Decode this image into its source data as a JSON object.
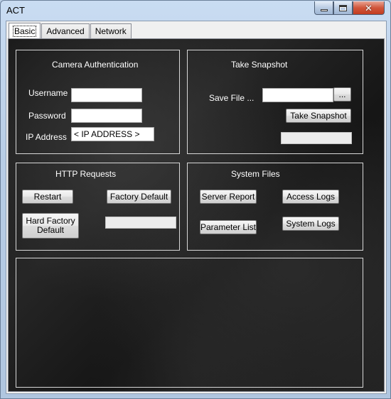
{
  "window": {
    "title": "ACT"
  },
  "tabs": [
    {
      "label": "Basic",
      "active": true
    },
    {
      "label": "Advanced",
      "active": false
    },
    {
      "label": "Network",
      "active": false
    }
  ],
  "camera_auth": {
    "title": "Camera Authentication",
    "username_label": "Username",
    "username_value": "",
    "password_label": "Password",
    "password_value": "",
    "ip_label": "IP Address",
    "ip_value": "< IP ADDRESS >"
  },
  "snapshot": {
    "title": "Take Snapshot",
    "save_file_label": "Save File ...",
    "save_file_value": "",
    "browse_label": "...",
    "take_label": "Take Snapshot",
    "status_value": ""
  },
  "http": {
    "title": "HTTP Requests",
    "restart_label": "Restart",
    "factory_default_label": "Factory Default",
    "hard_factory_default_label": "Hard Factory Default",
    "status_value": ""
  },
  "system_files": {
    "title": "System Files",
    "server_report_label": "Server Report",
    "access_logs_label": "Access Logs",
    "parameter_list_label": "Parameter List",
    "system_logs_label": "System Logs"
  },
  "colors": {
    "panel_background": "#1c1c1c",
    "group_border": "#d8d8d8",
    "label_text": "#ffffff"
  }
}
